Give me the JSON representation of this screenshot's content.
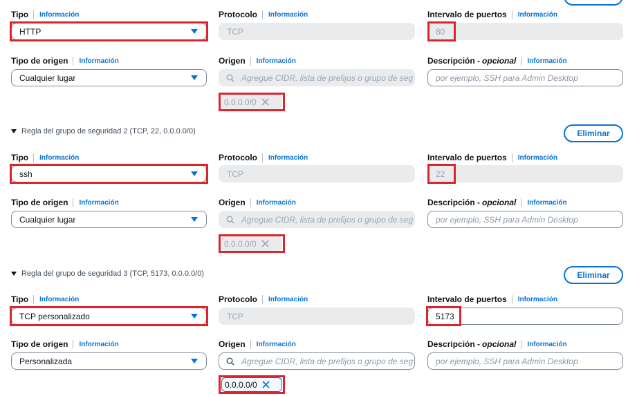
{
  "labels": {
    "tipo": "Tipo",
    "protocolo": "Protocolo",
    "intervalo": "Intervalo de puertos",
    "tipo_origen": "Tipo de origen",
    "origen": "Origen",
    "descripcion": "Descripción -",
    "opcional": "opcional",
    "info": "Información"
  },
  "placeholders": {
    "origen": "Agregue CIDR, lista de prefijos o grupo de seg",
    "descripcion": "por ejemplo, SSH para Admin Desktop"
  },
  "buttons": {
    "delete": "Eliminar"
  },
  "rules": [
    {
      "tipo": "HTTP",
      "protocolo": "TCP",
      "puertos": "80",
      "tipo_origen": "Cualquier lugar",
      "cidr": "0.0.0.0/0"
    },
    {
      "heading": "Regla del grupo de seguridad 2 (TCP, 22, 0.0.0.0/0)",
      "tipo": "ssh",
      "protocolo": "TCP",
      "puertos": "22",
      "tipo_origen": "Cualquier lugar",
      "cidr": "0.0.0.0/0"
    },
    {
      "heading": "Regla del grupo de seguridad 3 (TCP, 5173, 0.0.0.0/0)",
      "tipo": "TCP personalizado",
      "protocolo": "TCP",
      "puertos": "5173",
      "tipo_origen": "Personalizada",
      "cidr": "0.0.0.0/0"
    }
  ],
  "colors": {
    "accent": "#0972d3",
    "highlight": "#d9262c",
    "disabled_bg": "#e9ebed"
  },
  "icons": [
    "caret-down-icon",
    "search-icon",
    "remove-x-icon",
    "expand-triangle-icon"
  ]
}
